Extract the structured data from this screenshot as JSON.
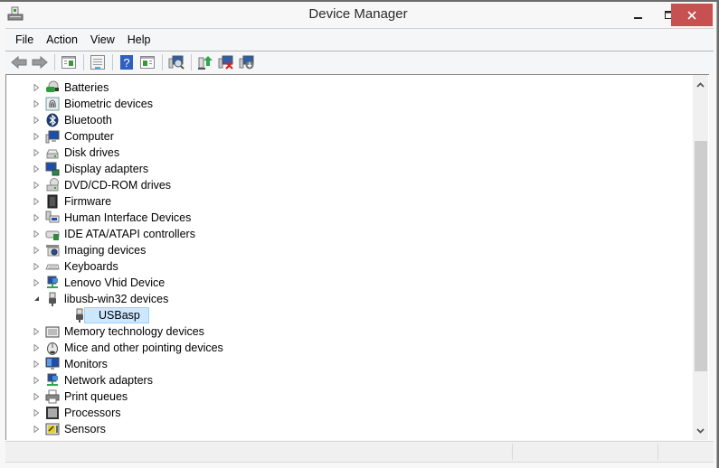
{
  "window": {
    "title": "Device Manager",
    "controls": {
      "minimize": "minimize",
      "maximize": "maximize",
      "close": "close"
    },
    "close_color": "#c75050"
  },
  "menu": [
    {
      "label": "File"
    },
    {
      "label": "Action"
    },
    {
      "label": "View"
    },
    {
      "label": "Help"
    }
  ],
  "toolbar": [
    {
      "icon": "back-arrow-icon",
      "tooltip": "Back"
    },
    {
      "icon": "forward-arrow-icon",
      "tooltip": "Forward"
    },
    {
      "icon": "show-hide-console-tree-icon",
      "tooltip": "Show/Hide Console Tree"
    },
    {
      "icon": "properties-icon",
      "tooltip": "Properties"
    },
    {
      "icon": "help-icon",
      "tooltip": "Help"
    },
    {
      "icon": "show-action-pane-icon",
      "tooltip": "Show/Hide Action Pane"
    },
    {
      "icon": "scan-hardware-icon",
      "tooltip": "Scan for hardware changes"
    },
    {
      "icon": "update-driver-icon",
      "tooltip": "Update Driver Software"
    },
    {
      "icon": "uninstall-device-icon",
      "tooltip": "Uninstall"
    },
    {
      "icon": "disable-device-icon",
      "tooltip": "Disable"
    }
  ],
  "tree": {
    "items": [
      {
        "label": "Batteries",
        "icon": "battery-icon",
        "expanded": false,
        "level": 0
      },
      {
        "label": "Biometric devices",
        "icon": "fingerprint-icon",
        "expanded": false,
        "level": 0
      },
      {
        "label": "Bluetooth",
        "icon": "bluetooth-icon",
        "expanded": false,
        "level": 0
      },
      {
        "label": "Computer",
        "icon": "computer-icon",
        "expanded": false,
        "level": 0
      },
      {
        "label": "Disk drives",
        "icon": "disk-drive-icon",
        "expanded": false,
        "level": 0
      },
      {
        "label": "Display adapters",
        "icon": "display-adapter-icon",
        "expanded": false,
        "level": 0
      },
      {
        "label": "DVD/CD-ROM drives",
        "icon": "dvd-drive-icon",
        "expanded": false,
        "level": 0
      },
      {
        "label": "Firmware",
        "icon": "firmware-chip-icon",
        "expanded": false,
        "level": 0
      },
      {
        "label": "Human Interface Devices",
        "icon": "hid-icon",
        "expanded": false,
        "level": 0
      },
      {
        "label": "IDE ATA/ATAPI controllers",
        "icon": "ide-controller-icon",
        "expanded": false,
        "level": 0
      },
      {
        "label": "Imaging devices",
        "icon": "camera-icon",
        "expanded": false,
        "level": 0
      },
      {
        "label": "Keyboards",
        "icon": "keyboard-icon",
        "expanded": false,
        "level": 0
      },
      {
        "label": "Lenovo Vhid Device",
        "icon": "network-device-icon",
        "expanded": false,
        "level": 0
      },
      {
        "label": "libusb-win32 devices",
        "icon": "usb-plug-icon",
        "expanded": true,
        "level": 0
      },
      {
        "label": "USBasp",
        "icon": "usb-plug-icon",
        "expanded": null,
        "level": 1,
        "selected": true
      },
      {
        "label": "Memory technology devices",
        "icon": "memory-device-icon",
        "expanded": false,
        "level": 0
      },
      {
        "label": "Mice and other pointing devices",
        "icon": "mouse-icon",
        "expanded": false,
        "level": 0
      },
      {
        "label": "Monitors",
        "icon": "monitor-icon",
        "expanded": false,
        "level": 0
      },
      {
        "label": "Network adapters",
        "icon": "network-adapter-icon",
        "expanded": false,
        "level": 0
      },
      {
        "label": "Print queues",
        "icon": "printer-icon",
        "expanded": false,
        "level": 0
      },
      {
        "label": "Processors",
        "icon": "processor-icon",
        "expanded": false,
        "level": 0
      },
      {
        "label": "Sensors",
        "icon": "sensor-icon",
        "expanded": false,
        "level": 0
      }
    ],
    "selection_color": "#cce8ff",
    "selection_border": "#99d1ff"
  },
  "scrollbar": {
    "position_fraction": 0.15,
    "visible_fraction": 0.69
  },
  "statusbar": {
    "panes": [
      "",
      "",
      ""
    ]
  }
}
